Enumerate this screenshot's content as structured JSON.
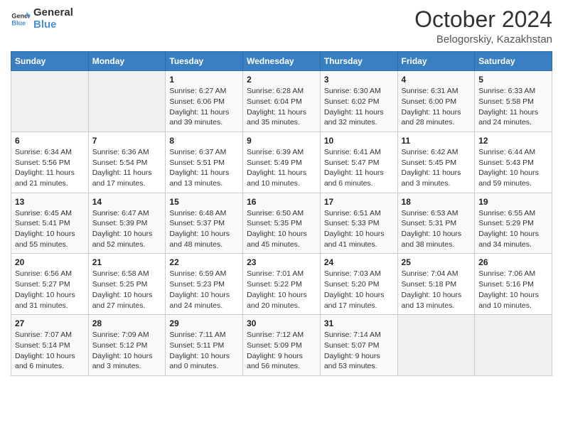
{
  "header": {
    "logo_general": "General",
    "logo_blue": "Blue",
    "month": "October 2024",
    "location": "Belogorskiy, Kazakhstan"
  },
  "days_of_week": [
    "Sunday",
    "Monday",
    "Tuesday",
    "Wednesday",
    "Thursday",
    "Friday",
    "Saturday"
  ],
  "weeks": [
    [
      {
        "day": "",
        "content": ""
      },
      {
        "day": "",
        "content": ""
      },
      {
        "day": "1",
        "content": "Sunrise: 6:27 AM\nSunset: 6:06 PM\nDaylight: 11 hours and 39 minutes."
      },
      {
        "day": "2",
        "content": "Sunrise: 6:28 AM\nSunset: 6:04 PM\nDaylight: 11 hours and 35 minutes."
      },
      {
        "day": "3",
        "content": "Sunrise: 6:30 AM\nSunset: 6:02 PM\nDaylight: 11 hours and 32 minutes."
      },
      {
        "day": "4",
        "content": "Sunrise: 6:31 AM\nSunset: 6:00 PM\nDaylight: 11 hours and 28 minutes."
      },
      {
        "day": "5",
        "content": "Sunrise: 6:33 AM\nSunset: 5:58 PM\nDaylight: 11 hours and 24 minutes."
      }
    ],
    [
      {
        "day": "6",
        "content": "Sunrise: 6:34 AM\nSunset: 5:56 PM\nDaylight: 11 hours and 21 minutes."
      },
      {
        "day": "7",
        "content": "Sunrise: 6:36 AM\nSunset: 5:54 PM\nDaylight: 11 hours and 17 minutes."
      },
      {
        "day": "8",
        "content": "Sunrise: 6:37 AM\nSunset: 5:51 PM\nDaylight: 11 hours and 13 minutes."
      },
      {
        "day": "9",
        "content": "Sunrise: 6:39 AM\nSunset: 5:49 PM\nDaylight: 11 hours and 10 minutes."
      },
      {
        "day": "10",
        "content": "Sunrise: 6:41 AM\nSunset: 5:47 PM\nDaylight: 11 hours and 6 minutes."
      },
      {
        "day": "11",
        "content": "Sunrise: 6:42 AM\nSunset: 5:45 PM\nDaylight: 11 hours and 3 minutes."
      },
      {
        "day": "12",
        "content": "Sunrise: 6:44 AM\nSunset: 5:43 PM\nDaylight: 10 hours and 59 minutes."
      }
    ],
    [
      {
        "day": "13",
        "content": "Sunrise: 6:45 AM\nSunset: 5:41 PM\nDaylight: 10 hours and 55 minutes."
      },
      {
        "day": "14",
        "content": "Sunrise: 6:47 AM\nSunset: 5:39 PM\nDaylight: 10 hours and 52 minutes."
      },
      {
        "day": "15",
        "content": "Sunrise: 6:48 AM\nSunset: 5:37 PM\nDaylight: 10 hours and 48 minutes."
      },
      {
        "day": "16",
        "content": "Sunrise: 6:50 AM\nSunset: 5:35 PM\nDaylight: 10 hours and 45 minutes."
      },
      {
        "day": "17",
        "content": "Sunrise: 6:51 AM\nSunset: 5:33 PM\nDaylight: 10 hours and 41 minutes."
      },
      {
        "day": "18",
        "content": "Sunrise: 6:53 AM\nSunset: 5:31 PM\nDaylight: 10 hours and 38 minutes."
      },
      {
        "day": "19",
        "content": "Sunrise: 6:55 AM\nSunset: 5:29 PM\nDaylight: 10 hours and 34 minutes."
      }
    ],
    [
      {
        "day": "20",
        "content": "Sunrise: 6:56 AM\nSunset: 5:27 PM\nDaylight: 10 hours and 31 minutes."
      },
      {
        "day": "21",
        "content": "Sunrise: 6:58 AM\nSunset: 5:25 PM\nDaylight: 10 hours and 27 minutes."
      },
      {
        "day": "22",
        "content": "Sunrise: 6:59 AM\nSunset: 5:23 PM\nDaylight: 10 hours and 24 minutes."
      },
      {
        "day": "23",
        "content": "Sunrise: 7:01 AM\nSunset: 5:22 PM\nDaylight: 10 hours and 20 minutes."
      },
      {
        "day": "24",
        "content": "Sunrise: 7:03 AM\nSunset: 5:20 PM\nDaylight: 10 hours and 17 minutes."
      },
      {
        "day": "25",
        "content": "Sunrise: 7:04 AM\nSunset: 5:18 PM\nDaylight: 10 hours and 13 minutes."
      },
      {
        "day": "26",
        "content": "Sunrise: 7:06 AM\nSunset: 5:16 PM\nDaylight: 10 hours and 10 minutes."
      }
    ],
    [
      {
        "day": "27",
        "content": "Sunrise: 7:07 AM\nSunset: 5:14 PM\nDaylight: 10 hours and 6 minutes."
      },
      {
        "day": "28",
        "content": "Sunrise: 7:09 AM\nSunset: 5:12 PM\nDaylight: 10 hours and 3 minutes."
      },
      {
        "day": "29",
        "content": "Sunrise: 7:11 AM\nSunset: 5:11 PM\nDaylight: 10 hours and 0 minutes."
      },
      {
        "day": "30",
        "content": "Sunrise: 7:12 AM\nSunset: 5:09 PM\nDaylight: 9 hours and 56 minutes."
      },
      {
        "day": "31",
        "content": "Sunrise: 7:14 AM\nSunset: 5:07 PM\nDaylight: 9 hours and 53 minutes."
      },
      {
        "day": "",
        "content": ""
      },
      {
        "day": "",
        "content": ""
      }
    ]
  ]
}
